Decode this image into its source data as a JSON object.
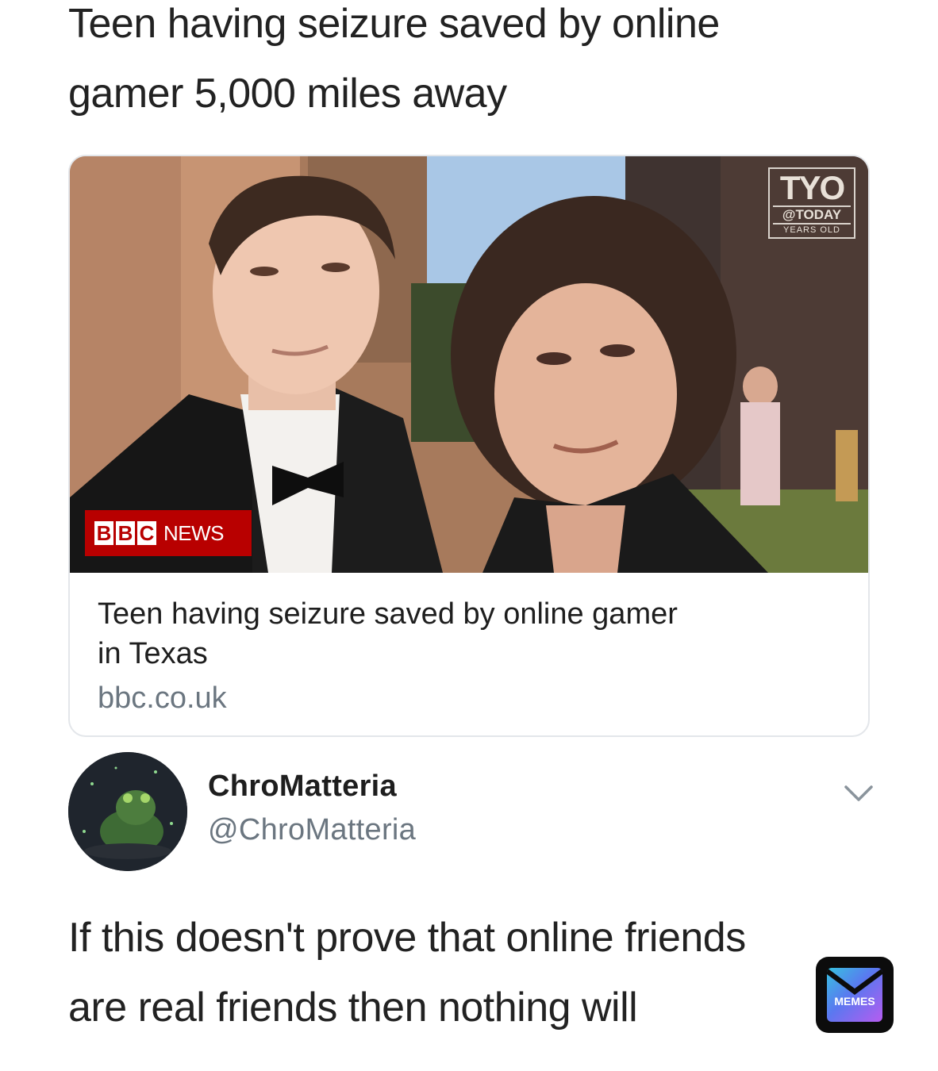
{
  "headline": {
    "line1": "Teen having seizure saved by online",
    "line2": "gamer 5,000 miles away"
  },
  "link_card": {
    "image_badge_left": {
      "blocks": [
        "B",
        "B",
        "C"
      ],
      "label": "NEWS"
    },
    "image_badge_right": {
      "main": "TYO",
      "sub": "@TODAY",
      "small": "YEARS OLD"
    },
    "title_line1": "Teen having seizure saved by online gamer",
    "title_line2": "in Texas",
    "domain": "bbc.co.uk"
  },
  "tweet": {
    "author_name": "ChroMatteria",
    "author_handle": "@ChroMatteria",
    "avatar_icon": "frog-avatar",
    "menu_icon": "chevron-down-icon",
    "text_line1": "If this doesn't prove that online friends",
    "text_line2": "are real friends then nothing will"
  },
  "watermark": {
    "label": "MEMES",
    "icon": "memes-logo-icon"
  },
  "colors": {
    "bbc_red": "#b80000",
    "muted_text": "#6b7680",
    "card_border": "#e3e6ea"
  }
}
